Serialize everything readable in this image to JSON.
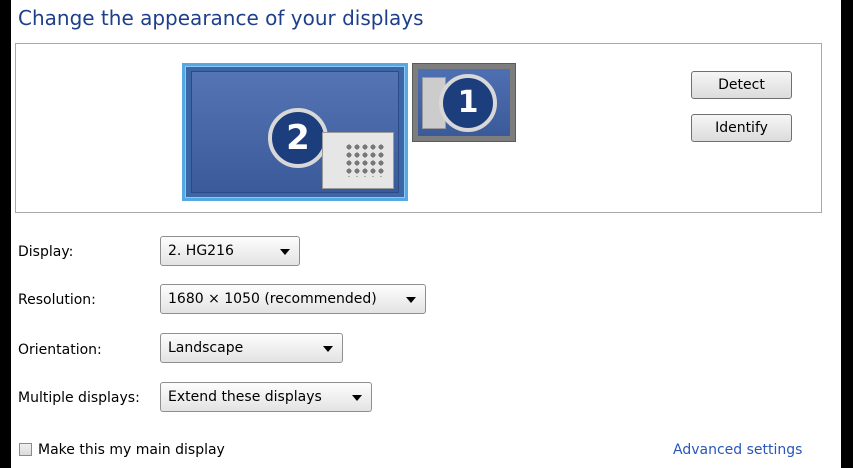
{
  "page": {
    "title": "Change the appearance of your displays"
  },
  "preview": {
    "monitors": [
      {
        "number": "2",
        "selected": true
      },
      {
        "number": "1",
        "selected": false
      }
    ],
    "detect_label": "Detect",
    "identify_label": "Identify"
  },
  "settings": {
    "display": {
      "label": "Display:",
      "value": "2. HG216"
    },
    "resolution": {
      "label": "Resolution:",
      "value": "1680 × 1050 (recommended)"
    },
    "orientation": {
      "label": "Orientation:",
      "value": "Landscape"
    },
    "multiple_displays": {
      "label": "Multiple displays:",
      "value": "Extend these displays"
    }
  },
  "main_display": {
    "label": "Make this my main display",
    "checked": false
  },
  "advanced_link": "Advanced settings",
  "colors": {
    "title": "#1e3f8a",
    "link": "#2a56b8",
    "selection": "#54a9e3"
  }
}
